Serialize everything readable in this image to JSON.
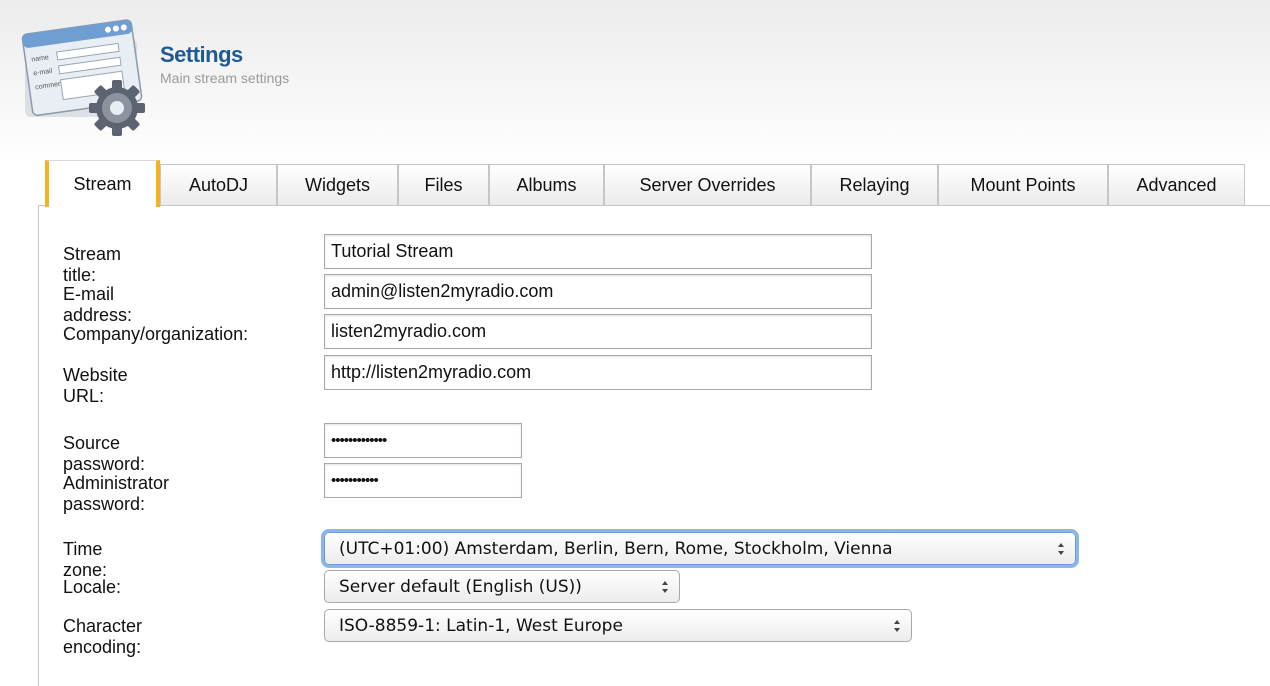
{
  "header": {
    "title": "Settings",
    "subtitle": "Main stream settings",
    "icon_form_labels": [
      "name",
      "e-mail",
      "comments"
    ]
  },
  "tabs": [
    {
      "label": "Stream",
      "active": true
    },
    {
      "label": "AutoDJ"
    },
    {
      "label": "Widgets"
    },
    {
      "label": "Files"
    },
    {
      "label": "Albums"
    },
    {
      "label": "Server Overrides"
    },
    {
      "label": "Relaying"
    },
    {
      "label": "Mount Points"
    },
    {
      "label": "Advanced"
    }
  ],
  "form": {
    "stream_title": {
      "label": "Stream title:",
      "value": "Tutorial Stream"
    },
    "email": {
      "label": "E-mail address:",
      "value": "admin@listen2myradio.com"
    },
    "company": {
      "label": "Company/organization:",
      "value": "listen2myradio.com"
    },
    "website": {
      "label": "Website URL:",
      "value": "http://listen2myradio.com"
    },
    "source_password": {
      "label": "Source password:",
      "masked": "•••••••••••••"
    },
    "admin_password": {
      "label": "Administrator password:",
      "masked": "•••••••••••"
    },
    "time_zone": {
      "label": "Time zone:",
      "value": "(UTC+01:00) Amsterdam, Berlin, Bern, Rome, Stockholm, Vienna"
    },
    "locale": {
      "label": "Locale:",
      "value": "Server default (English (US))"
    },
    "encoding": {
      "label": "Character encoding:",
      "value": "ISO-8859-1: Latin-1, West Europe"
    }
  },
  "colors": {
    "title": "#1f5a96",
    "active_tab_accent": "#f5b224",
    "focus_ring": "#8db6e8"
  }
}
